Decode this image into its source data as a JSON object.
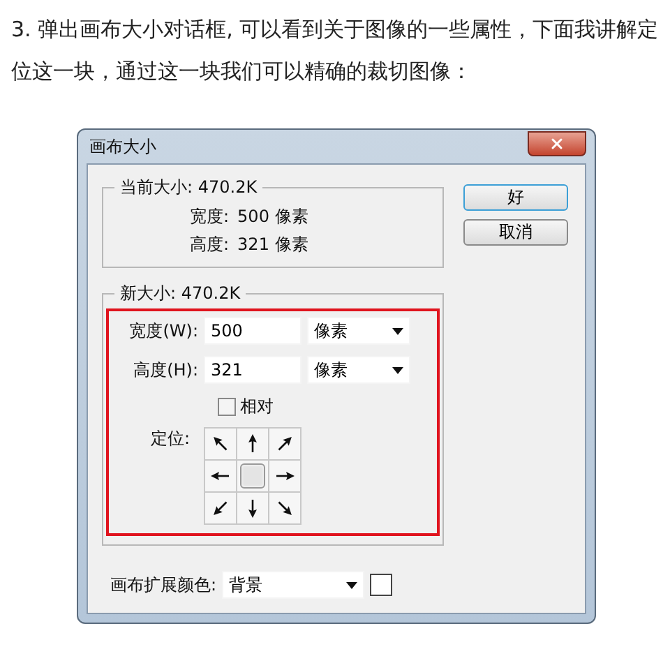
{
  "article": {
    "paragraph": "3. 弹出画布大小对话框, 可以看到关于图像的一些属性，下面我讲解定位这一块，通过这一块我们可以精确的裁切图像："
  },
  "dialog": {
    "title": "画布大小",
    "current_size": {
      "legend": "当前大小: 470.2K",
      "rows": [
        {
          "label": "宽度:",
          "value": "500 像素"
        },
        {
          "label": "高度:",
          "value": "321 像素"
        }
      ]
    },
    "new_size": {
      "legend": "新大小: 470.2K",
      "highlighted": true,
      "fields": [
        {
          "label": "宽度(W):",
          "value": "500",
          "unit": "像素"
        },
        {
          "label": "高度(H):",
          "value": "321",
          "unit": "像素"
        }
      ],
      "relative": {
        "label": "相对",
        "checked": false
      },
      "anchor": {
        "label": "定位:",
        "cells": [
          {
            "selected": false
          },
          {
            "selected": false
          },
          {
            "selected": false
          },
          {
            "selected": false
          },
          {
            "selected": true
          },
          {
            "selected": false
          },
          {
            "selected": false
          },
          {
            "selected": false
          },
          {
            "selected": false
          }
        ]
      }
    },
    "extension_color": {
      "label": "画布扩展颜色:",
      "value": "背景",
      "color": "#ffffff"
    },
    "buttons": [
      {
        "label": "好",
        "default": true
      },
      {
        "label": "取消",
        "default": false
      }
    ]
  }
}
